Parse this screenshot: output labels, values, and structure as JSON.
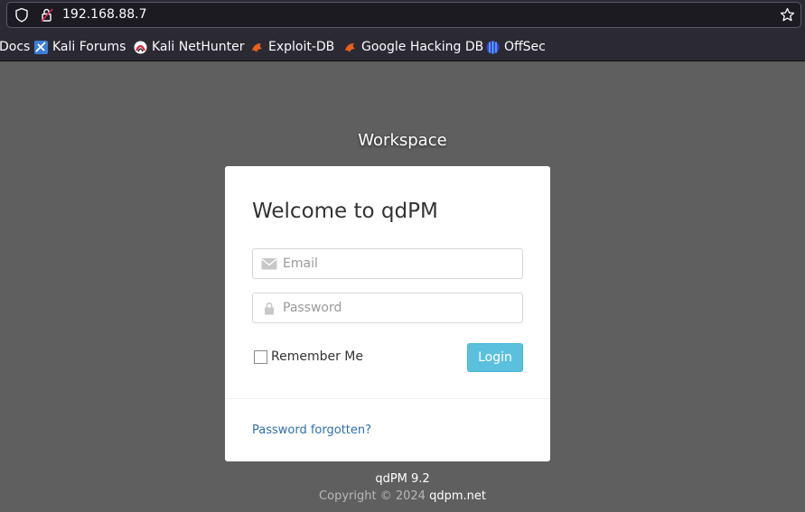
{
  "browser": {
    "url": "192.168.88.7",
    "bookmarks": [
      {
        "label": "Docs",
        "icon": "kali-docs-icon"
      },
      {
        "label": "Kali Forums",
        "icon": "kali-forums-icon"
      },
      {
        "label": "Kali NetHunter",
        "icon": "kali-nethunter-icon"
      },
      {
        "label": "Exploit-DB",
        "icon": "exploit-db-icon"
      },
      {
        "label": "Google Hacking DB",
        "icon": "exploit-db-icon"
      },
      {
        "label": "OffSec",
        "icon": "offsec-icon"
      }
    ]
  },
  "page": {
    "workspace_title": "Workspace",
    "heading": "Welcome to qdPM",
    "email_placeholder": "Email",
    "password_placeholder": "Password",
    "remember_label": "Remember Me",
    "login_label": "Login",
    "forgot_label": "Password forgotten?",
    "version": "qdPM 9.2",
    "copyright_text": "Copyright © 2024",
    "copyright_link": "qdpm.net"
  },
  "colors": {
    "background": "#5f5f5f",
    "login_button": "#5bc0de",
    "link": "#2f6fa7"
  }
}
